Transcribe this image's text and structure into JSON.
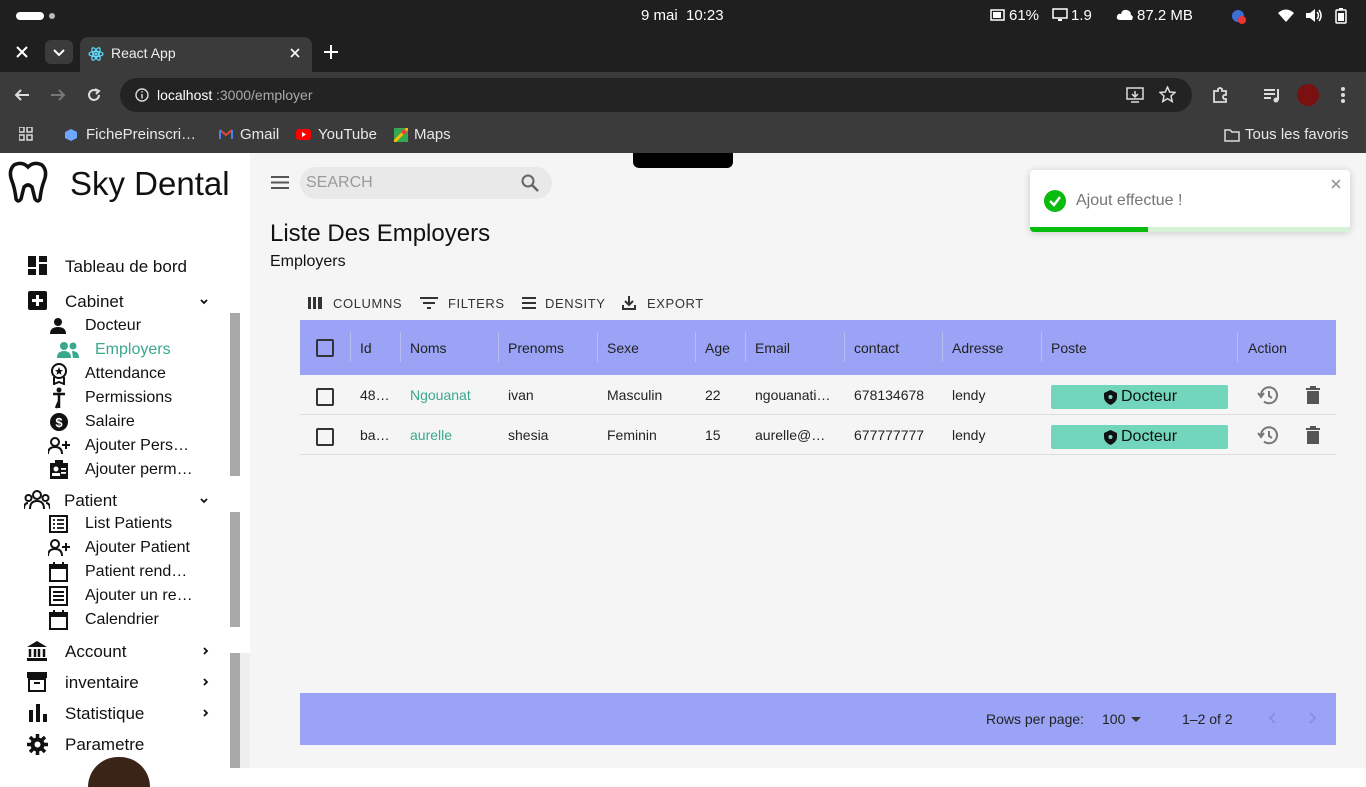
{
  "status_bar": {
    "date": "9 mai",
    "time": "10:23",
    "battery": "61%",
    "load": "1.9",
    "memory": "87.2 MB"
  },
  "browser": {
    "tab_title": "React App",
    "url_host": "localhost",
    "url_path": ":3000/employer",
    "bookmarks": [
      "FichePreinscri…",
      "Gmail",
      "YouTube",
      "Maps"
    ],
    "all_bookmarks": "Tous les favoris"
  },
  "sidebar": {
    "brand": "Sky Dental",
    "items": [
      {
        "label": "Tableau de bord",
        "icon": "dashboard-icon"
      },
      {
        "label": "Cabinet",
        "icon": "medical-cross-icon"
      },
      {
        "label": "Docteur",
        "icon": "person-icon"
      },
      {
        "label": "Employers",
        "icon": "people-icon"
      },
      {
        "label": "Attendance",
        "icon": "badge-icon"
      },
      {
        "label": "Permissions",
        "icon": "standing-person-icon"
      },
      {
        "label": "Salaire",
        "icon": "dollar-icon"
      },
      {
        "label": "Ajouter Pers…",
        "icon": "person-add-icon"
      },
      {
        "label": "Ajouter perm…",
        "icon": "contact-card-icon"
      },
      {
        "label": "Patient",
        "icon": "group-icon"
      },
      {
        "label": "List Patients",
        "icon": "list-icon"
      },
      {
        "label": "Ajouter Patient",
        "icon": "person-add-icon"
      },
      {
        "label": "Patient rend…",
        "icon": "calendar-icon"
      },
      {
        "label": "Ajouter un re…",
        "icon": "list-alt-icon"
      },
      {
        "label": "Calendrier",
        "icon": "calendar-icon"
      },
      {
        "label": "Account",
        "icon": "bank-icon"
      },
      {
        "label": "inventaire",
        "icon": "archive-icon"
      },
      {
        "label": "Statistique",
        "icon": "bar-chart-icon"
      },
      {
        "label": "Parametre",
        "icon": "gear-icon"
      }
    ]
  },
  "main": {
    "search_placeholder": "SEARCH",
    "title": "Liste Des Employers",
    "subtitle": "Employers",
    "toolbar": [
      "COLUMNS",
      "FILTERS",
      "DENSITY",
      "EXPORT"
    ],
    "columns": [
      "Id",
      "Noms",
      "Prenoms",
      "Sexe",
      "Age",
      "Email",
      "contact",
      "Adresse",
      "Poste",
      "Action"
    ],
    "rows": [
      {
        "id": "48…",
        "nom": "Ngouanat",
        "prenom": "ivan",
        "sexe": "Masculin",
        "age": "22",
        "email": "ngouanati…",
        "contact": "678134678",
        "adresse": "lendy",
        "poste": "Docteur"
      },
      {
        "id": "ba…",
        "nom": "aurelle",
        "prenom": "shesia",
        "sexe": "Feminin",
        "age": "15",
        "email": "aurelle@…",
        "contact": "677777777",
        "adresse": "lendy",
        "poste": "Docteur"
      }
    ],
    "footer": {
      "rows_per_page_label": "Rows per page:",
      "rows_per_page": "100",
      "range": "1–2 of 2"
    }
  },
  "toast": {
    "message": "Ajout effectue !",
    "progress": 0.37
  },
  "colors": {
    "accent": "#3aa88c",
    "grid_header": "#9aa3f5",
    "badge": "#72d6bd"
  }
}
